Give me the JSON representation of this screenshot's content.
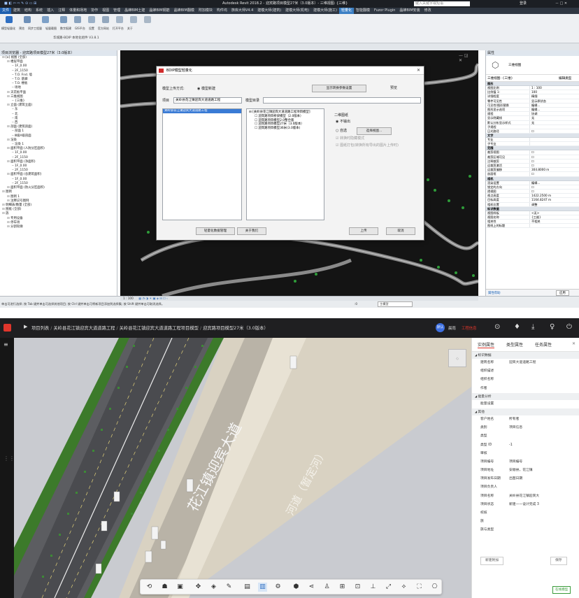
{
  "revit": {
    "title_center": "Autodesk Revit 2018.2 -",
    "title_file": "迎宾路项目模型27米（3.0版本）- 三维视图: {三维}",
    "search_placeholder": "键入关键字或短语",
    "login": "登录",
    "tabs": [
      "文件",
      "建筑",
      "结构",
      "系统",
      "插入",
      "注释",
      "体量和场地",
      "协作",
      "视图",
      "管理",
      "晶蜂BIM土建",
      "晶蜂BIM钢筋",
      "晶蜂BIM翻模",
      "附加模块",
      "构件坞",
      "族库大师V4.4",
      "建模大师(建筑)",
      "建模大师(机电)",
      "建模大师(施工)",
      "轻量化",
      "智能翻模",
      "Fuzor Plugin",
      "晶蜂BIM安装",
      "修改"
    ],
    "active_tab": "轻量化",
    "ribbon_labels": [
      "模型轻量化",
      "预览",
      "同步工程量",
      "轻量载图",
      "数字报建",
      "GIS平台",
      "设置",
      "官方网站",
      "打开平台",
      "关于"
    ],
    "ribbon_group": "华城路-BDIP 本地化组件 V3.8.1"
  },
  "project_browser": {
    "title": "项目浏览器 - 迎宾路项目模型27米（3.0版本）",
    "items": [
      {
        "t": "[o] 视图 (全部)",
        "d": 0
      },
      {
        "t": "楼层平面",
        "d": 1
      },
      {
        "t": "1F_0.00",
        "d": 2
      },
      {
        "t": "2F_1150",
        "d": 2
      },
      {
        "t": "T.O. Fnd. 墙",
        "d": 2
      },
      {
        "t": "T.O. 基脚",
        "d": 2
      },
      {
        "t": "T.O. 楼板",
        "d": 2
      },
      {
        "t": "场地",
        "d": 2
      },
      {
        "t": "天花板平面",
        "d": 1
      },
      {
        "t": "三维视图",
        "d": 1
      },
      {
        "t": "{三维}",
        "d": 2
      },
      {
        "t": "立面 (建筑立面)",
        "d": 1
      },
      {
        "t": "东",
        "d": 2
      },
      {
        "t": "北",
        "d": 2
      },
      {
        "t": "南",
        "d": 2
      },
      {
        "t": "西",
        "d": 2
      },
      {
        "t": "剖面 (建筑剖面)",
        "d": 1
      },
      {
        "t": "剖面 1",
        "d": 2
      },
      {
        "t": "Ⅲ级A级剖面",
        "d": 2
      },
      {
        "t": "渲染",
        "d": 1
      },
      {
        "t": "渲染 1",
        "d": 2
      },
      {
        "t": "面积平面 (人防分区面积)",
        "d": 1
      },
      {
        "t": "1F_0.00",
        "d": 2
      },
      {
        "t": "2F_1150",
        "d": 2
      },
      {
        "t": "面积平面 (净面积)",
        "d": 1
      },
      {
        "t": "1F_0.00",
        "d": 2
      },
      {
        "t": "2F_1150",
        "d": 2
      },
      {
        "t": "面积平面 (总建筑面积)",
        "d": 1
      },
      {
        "t": "1F_0.00",
        "d": 2
      },
      {
        "t": "2F_1150",
        "d": 2
      },
      {
        "t": "面积平面 (防火分区面积)",
        "d": 1
      },
      {
        "t": "图例",
        "d": 0
      },
      {
        "t": "图例 1",
        "d": 1
      },
      {
        "t": "注释记号图例",
        "d": 1
      },
      {
        "t": "明细表/数量 (全部)",
        "d": 0
      },
      {
        "t": "图纸 (全部)",
        "d": 0
      },
      {
        "t": "族",
        "d": 0
      },
      {
        "t": "专用设备",
        "d": 1
      },
      {
        "t": "停车场",
        "d": 1
      },
      {
        "t": "分割轮廓",
        "d": 1
      }
    ]
  },
  "properties": {
    "title": "属性",
    "type_name": "三维视图",
    "selector": "三维视图: {三维}",
    "edit_type": "编辑类型",
    "rows": [
      {
        "s": "图形"
      },
      {
        "k": "视图比例",
        "v": "1 : 100"
      },
      {
        "k": "比例值 1:",
        "v": "100"
      },
      {
        "k": "详细程度",
        "v": "精细"
      },
      {
        "k": "零件可见性",
        "v": "显示原状态"
      },
      {
        "k": "可见性/图形替换",
        "v": "编辑..."
      },
      {
        "k": "图形显示选项",
        "v": "编辑..."
      },
      {
        "k": "规程",
        "v": "协调"
      },
      {
        "k": "显示隐藏线",
        "v": "无"
      },
      {
        "k": "默认分析显示样式",
        "v": "无"
      },
      {
        "k": "子规程",
        "v": ""
      },
      {
        "k": "日光路径",
        "v": "☐"
      },
      {
        "s": "文字"
      },
      {
        "k": "专业",
        "v": ""
      },
      {
        "k": "子专业",
        "v": ""
      },
      {
        "s": "范围"
      },
      {
        "k": "裁剪视图",
        "v": "☐"
      },
      {
        "k": "裁剪区域可见",
        "v": "☐"
      },
      {
        "k": "注释裁剪",
        "v": "☐"
      },
      {
        "k": "远裁剪激活",
        "v": "☐"
      },
      {
        "k": "远裁剪偏移",
        "v": "304.8000 m"
      },
      {
        "k": "剖面框",
        "v": "☐"
      },
      {
        "s": "相机"
      },
      {
        "k": "渲染设置",
        "v": "编辑..."
      },
      {
        "k": "锁定的方向",
        "v": "☐"
      },
      {
        "k": "透视图",
        "v": "☐"
      },
      {
        "k": "视点高度",
        "v": "1422.2500 m"
      },
      {
        "k": "目标高度",
        "v": "1164.8247 m"
      },
      {
        "k": "相机位置",
        "v": "调整"
      },
      {
        "s": "标识数据"
      },
      {
        "k": "视图样板",
        "v": "<无>"
      },
      {
        "k": "视图名称",
        "v": "{三维}"
      },
      {
        "k": "相关性",
        "v": "不相关"
      },
      {
        "k": "图纸上的标题",
        "v": ""
      }
    ],
    "help": "属性帮助",
    "apply": "应用"
  },
  "status": {
    "scale": "1 : 100",
    "hint": "单击可进行选择; 按 Tab 键并单击可选择其他项目; 按 Ctrl 键并单击可将新项目添加到选择集; 按 Shift 键并单击可取消选择。",
    "count": ":0",
    "model": "主模型"
  },
  "dialog": {
    "title": "BDIP模型轻量化",
    "upload_mode_label": "模型上传方式:",
    "upload_mode_value": "模型新建",
    "convert_btn": "显示转换参数设置",
    "preview_label": "预览",
    "project_label": "项目",
    "project_value": "关岭县花江镇迎宾大道道路工程",
    "catalog_label": "模型目录",
    "left_list": [
      "关岭县花江镇迎宾大道道路工程"
    ],
    "tree": [
      "[关岭县花江镇迎宾大道道路工程项目模型]",
      "迎宾路项目桥梁模型（2.0版本）",
      "迎宾路项目模型2.0整合版",
      "迎宾路项目模型27米（3.0版本）",
      "迎宾路项目模型36米(3.0版本)"
    ],
    "drawing_group": "二维图纸",
    "opt_none": "不输出",
    "opt_select": "自选",
    "select_view_btn": "选择视图...",
    "chk1": "转换时隐藏模式",
    "chk2": "图纸打包(转换所有导出的图片上传时)",
    "btn_manage": "轻量化数据管理",
    "btn_about": "关于我们",
    "btn_upload": "上传",
    "btn_cancel": "取消"
  },
  "web": {
    "breadcrumb": [
      "项目列表",
      "关岭县花江镇迎宾大道道路工程",
      "关岭县花江镇迎宾大道道路工程项目模型",
      "迎宾路项目模型27米（3.0版本）"
    ],
    "user_badge": "默认",
    "user_name": "晨雨",
    "workspace": "工程信息",
    "road_label": "花江镇迎宾大道",
    "river_label": "河道（暂定河）",
    "panel_tabs": [
      "实例属性",
      "类型属性",
      "任务属性"
    ],
    "sections": [
      {
        "title": "标识数据",
        "rows": [
          {
            "k": "建筑名称",
            "v": "迎宾大道道路工程"
          },
          {
            "k": "组织描述",
            "v": ""
          },
          {
            "k": "组织名称",
            "v": ""
          },
          {
            "k": "作者",
            "v": ""
          }
        ]
      },
      {
        "title": "能量分析",
        "rows": [
          {
            "k": "能量设置",
            "v": ""
          }
        ]
      },
      {
        "title": "其他",
        "rows": [
          {
            "k": "客户姓名",
            "v": "所有者"
          },
          {
            "k": "类别",
            "v": "项目信息"
          },
          {
            "k": "类型",
            "v": ""
          },
          {
            "k": "类型 ID",
            "v": "-1"
          },
          {
            "k": "审核",
            "v": ""
          },
          {
            "k": "项目编号",
            "v": "项目编号"
          },
          {
            "k": "项目地址",
            "v": "安顺县，花江镇"
          },
          {
            "k": "项目发布日期",
            "v": "出图日期"
          },
          {
            "k": "项目负责人",
            "v": ""
          },
          {
            "k": "项目名称",
            "v": "关岭县花江镇迎宾大"
          },
          {
            "k": "项目状态",
            "v": "新建——设计完成 3"
          },
          {
            "k": "校核",
            "v": ""
          },
          {
            "k": "族",
            "v": ""
          },
          {
            "k": "族与类型",
            "v": ""
          }
        ]
      }
    ],
    "btn_new": "新建附加",
    "btn_save": "保存",
    "online_btn": "在线模型"
  },
  "colors": {
    "accent": "#3b7fc4",
    "web_red": "#e0362c",
    "badge_blue": "#3d6fe0"
  }
}
